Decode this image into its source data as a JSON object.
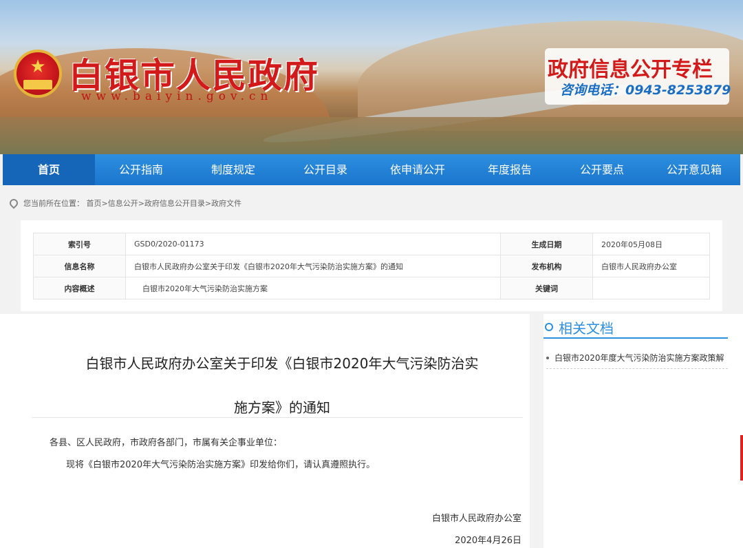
{
  "header": {
    "site_title": "白银市人民政府",
    "site_url": "www.baiyin.gov.cn",
    "info_title": "政府信息公开专栏",
    "info_phone": "咨询电话：0943-8253879"
  },
  "nav": {
    "items": [
      "首页",
      "公开指南",
      "制度规定",
      "公开目录",
      "依申请公开",
      "年度报告",
      "公开要点",
      "公开意见箱"
    ],
    "active_index": 0
  },
  "breadcrumb": {
    "text": "您当前所在位置： 首页>信息公开>政府信息公开目录>政府文件"
  },
  "meta": {
    "index_label": "索引号",
    "index_value": "GSD0/2020-01173",
    "date_label": "生成日期",
    "date_value": "2020年05月08日",
    "name_label": "信息名称",
    "name_value": "白银市人民政府办公室关于印发《白银市2020年大气污染防治实施方案》的通知",
    "org_label": "发布机构",
    "org_value": "白银市人民政府办公室",
    "summary_label": "内容概述",
    "summary_value": "白银市2020年大气污染防治实施方案",
    "keyword_label": "关键词",
    "keyword_value": ""
  },
  "article": {
    "title_line1": "白银市人民政府办公室关于印发《白银市2020年大气污染防治实",
    "title_line2": "施方案》的通知",
    "para1": "各县、区人民政府，市政府各部门，市属有关企事业单位：",
    "para2": "现将《白银市2020年大气污染防治实施方案》印发给你们，请认真遵照执行。",
    "signature": "白银市人民政府办公室",
    "date": "2020年4月26日"
  },
  "sidebar": {
    "title": "相关文档",
    "items": [
      "白银市2020年度大气污染防治实施方案政策解"
    ]
  },
  "colors": {
    "brand_red": "#d21a1a",
    "nav_blue": "#1a75cc",
    "accent_blue": "#2d8fe0"
  }
}
